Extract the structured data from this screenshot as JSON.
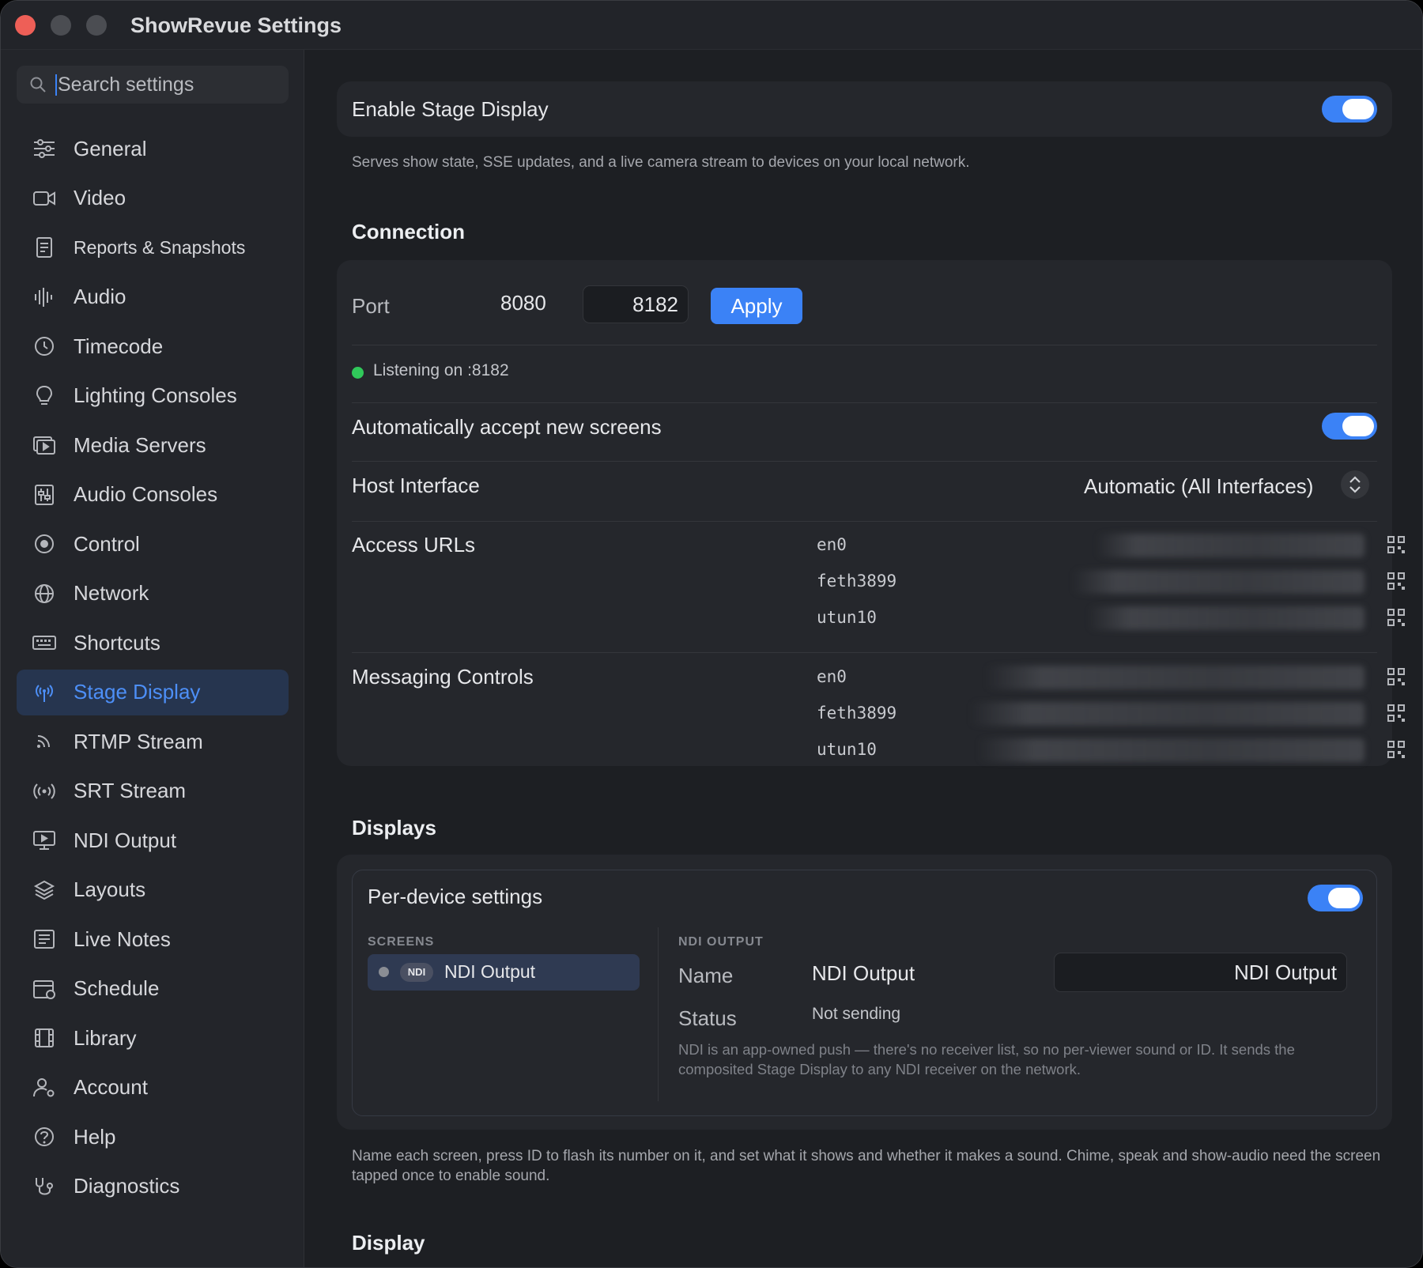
{
  "window": {
    "title": "ShowRevue Settings"
  },
  "search": {
    "placeholder": "Search settings"
  },
  "sidebar": {
    "items": [
      {
        "label": "General",
        "icon": "sliders-icon"
      },
      {
        "label": "Video",
        "icon": "video-camera-icon"
      },
      {
        "label": "Reports & Snapshots",
        "icon": "report-icon"
      },
      {
        "label": "Audio",
        "icon": "waveform-icon"
      },
      {
        "label": "Timecode",
        "icon": "clock-icon"
      },
      {
        "label": "Lighting Consoles",
        "icon": "lightbulb-icon"
      },
      {
        "label": "Media Servers",
        "icon": "media-server-icon"
      },
      {
        "label": "Audio Consoles",
        "icon": "mixer-icon"
      },
      {
        "label": "Control",
        "icon": "control-icon"
      },
      {
        "label": "Network",
        "icon": "globe-icon"
      },
      {
        "label": "Shortcuts",
        "icon": "keyboard-icon"
      },
      {
        "label": "Stage Display",
        "icon": "antenna-icon"
      },
      {
        "label": "RTMP Stream",
        "icon": "rss-icon"
      },
      {
        "label": "SRT Stream",
        "icon": "broadcast-icon"
      },
      {
        "label": "NDI Output",
        "icon": "monitor-icon"
      },
      {
        "label": "Layouts",
        "icon": "layouts-icon"
      },
      {
        "label": "Live Notes",
        "icon": "notes-icon"
      },
      {
        "label": "Schedule",
        "icon": "calendar-icon"
      },
      {
        "label": "Library",
        "icon": "film-icon"
      },
      {
        "label": "Account",
        "icon": "person-gear-icon"
      },
      {
        "label": "Help",
        "icon": "question-icon"
      },
      {
        "label": "Diagnostics",
        "icon": "stethoscope-icon"
      }
    ],
    "active": "Stage Display"
  },
  "stage": {
    "enable_label": "Enable Stage Display",
    "enable_on": true,
    "description": "Serves show state, SSE updates, and a live camera stream to devices on your local network."
  },
  "connection": {
    "title": "Connection",
    "port_label": "Port",
    "port_current": "8080",
    "port_input": "8182",
    "apply_label": "Apply",
    "status_text": "Listening on :8182",
    "status_color": "#30c85a",
    "auto_accept_label": "Automatically accept new screens",
    "auto_accept_on": true,
    "host_label": "Host Interface",
    "host_value": "Automatic (All Interfaces)",
    "access_label": "Access URLs",
    "access_interfaces": [
      "en0",
      "feth3899",
      "utun10"
    ],
    "messaging_label": "Messaging Controls",
    "messaging_interfaces": [
      "en0",
      "feth3899",
      "utun10"
    ]
  },
  "displays": {
    "title": "Displays",
    "per_device_label": "Per-device settings",
    "per_device_on": true,
    "screens_header": "SCREENS",
    "screen_badge": "NDI",
    "screen_name": "NDI Output",
    "ndi_header": "NDI OUTPUT",
    "name_label": "Name",
    "name_value": "NDI Output",
    "name_input": "NDI Output",
    "status_label": "Status",
    "status_value": "Not sending",
    "ndi_note": "NDI is an app-owned push — there's no receiver list, so no per-viewer sound or ID. It sends the composited Stage Display to any NDI receiver on the network.",
    "footer_note": "Name each screen, press ID to flash its number on it, and set what it shows and whether it makes a sound. Chime, speak and show-audio need the screen tapped once to enable sound."
  },
  "display": {
    "title": "Display"
  },
  "colors": {
    "accent": "#3b82f6",
    "background": "#1d1f23",
    "card": "#25272c"
  }
}
